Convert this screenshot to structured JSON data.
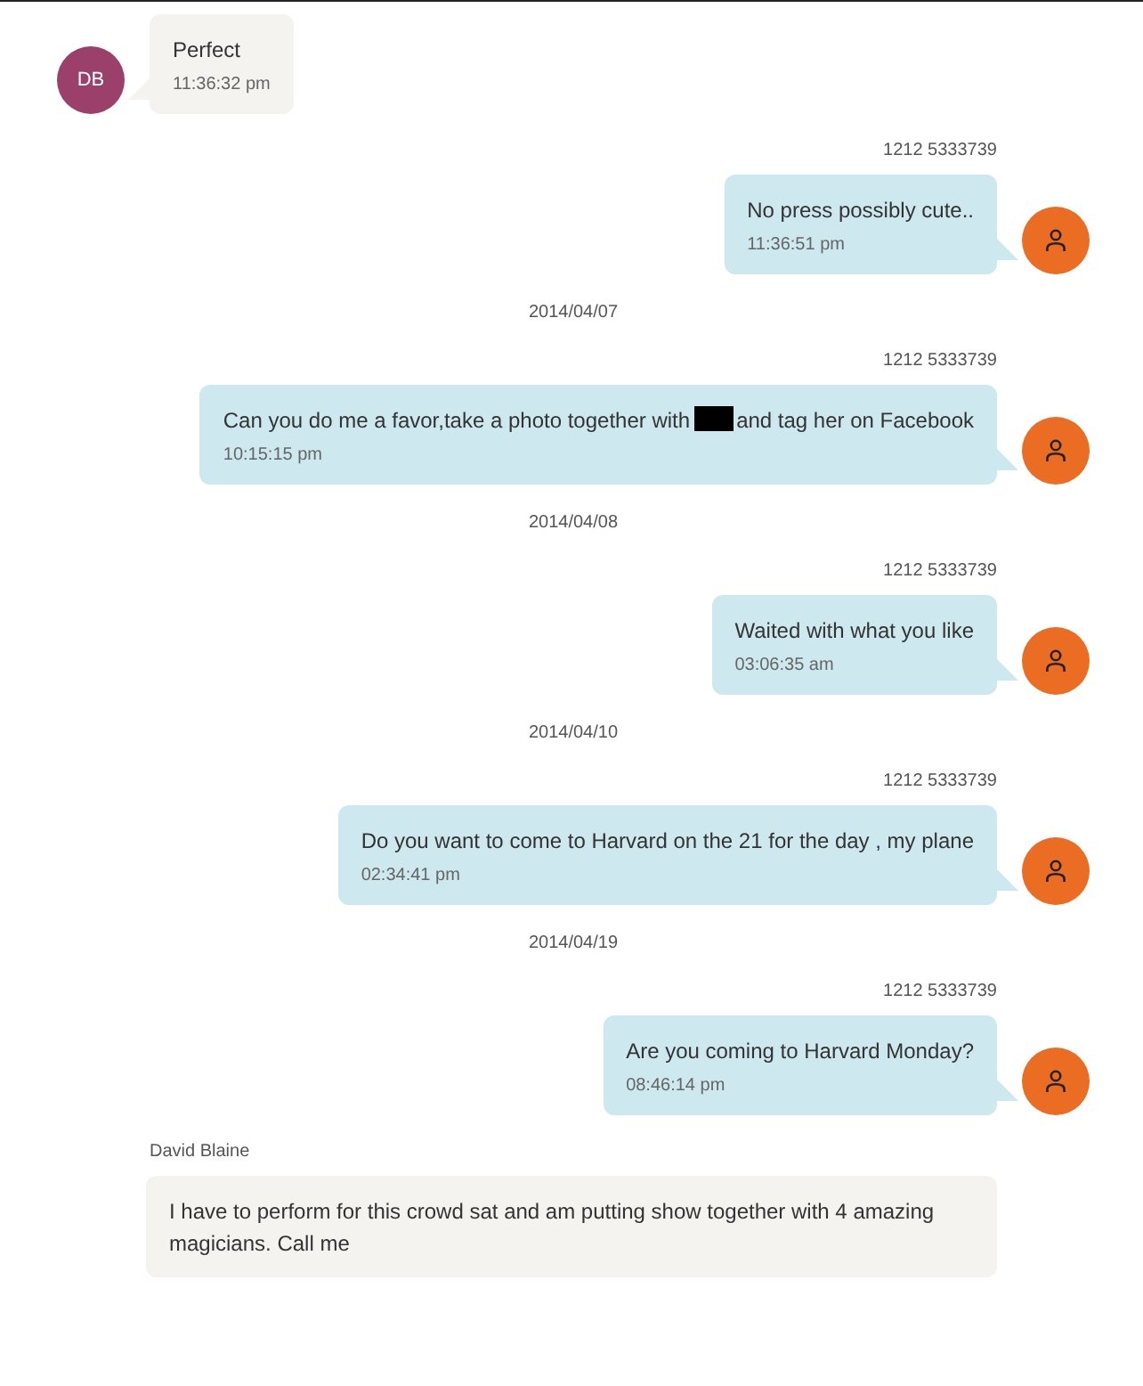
{
  "messages": [
    {
      "kind": "incoming",
      "avatar": {
        "initials": "DB",
        "color": "#9b3f6b"
      },
      "text": "Perfect",
      "time": "11:36:32 pm"
    },
    {
      "kind": "outgoing",
      "sender": "1212 5333739",
      "avatar": {
        "color": "#ea6d23"
      },
      "text": "No press possibly cute..",
      "time": "11:36:51 pm"
    },
    {
      "kind": "date",
      "text": "2014/04/07"
    },
    {
      "kind": "outgoing",
      "sender": "1212 5333739",
      "avatar": {
        "color": "#ea6d23"
      },
      "text": "Can you do me a favor,take a photo together with",
      "redacted": true,
      "text_after": "and tag her on Facebook",
      "time": "10:15:15 pm"
    },
    {
      "kind": "date",
      "text": "2014/04/08"
    },
    {
      "kind": "outgoing",
      "sender": "1212 5333739",
      "avatar": {
        "color": "#ea6d23"
      },
      "text": "Waited with what you like",
      "time": "03:06:35 am"
    },
    {
      "kind": "date",
      "text": "2014/04/10"
    },
    {
      "kind": "outgoing",
      "sender": "1212 5333739",
      "avatar": {
        "color": "#ea6d23"
      },
      "text": "Do you want to come to Harvard on the 21 for the day  , my plane",
      "time": "02:34:41 pm"
    },
    {
      "kind": "date",
      "text": "2014/04/19"
    },
    {
      "kind": "outgoing",
      "sender": "1212 5333739",
      "avatar": {
        "color": "#ea6d23"
      },
      "text": "Are you coming to Harvard Monday?",
      "time": "08:46:14 pm"
    },
    {
      "kind": "incoming",
      "sender": "David Blaine",
      "text": "I have to perform for this crowd sat and am putting show together with 4 amazing magicians. Call me"
    }
  ]
}
